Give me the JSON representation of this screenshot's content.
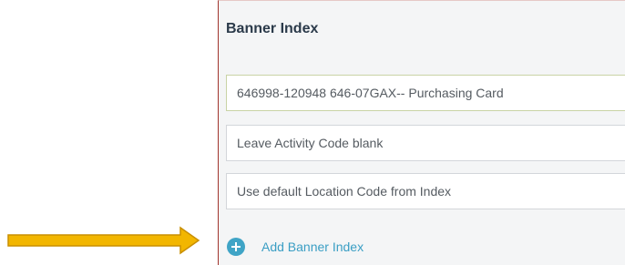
{
  "panel": {
    "title": "Banner Index",
    "fields": [
      "646998-120948 646-07GAX-- Purchasing Card",
      "Leave Activity Code blank",
      "Use default Location Code from Index"
    ],
    "add_button_label": "Add Banner Index",
    "add_icon": "plus-circle-icon"
  },
  "annotation": {
    "arrow_icon": "arrow-right-icon",
    "arrow_color": "#f2b600"
  },
  "colors": {
    "accent": "#3fa4c6",
    "panel_border": "#a2342d"
  }
}
